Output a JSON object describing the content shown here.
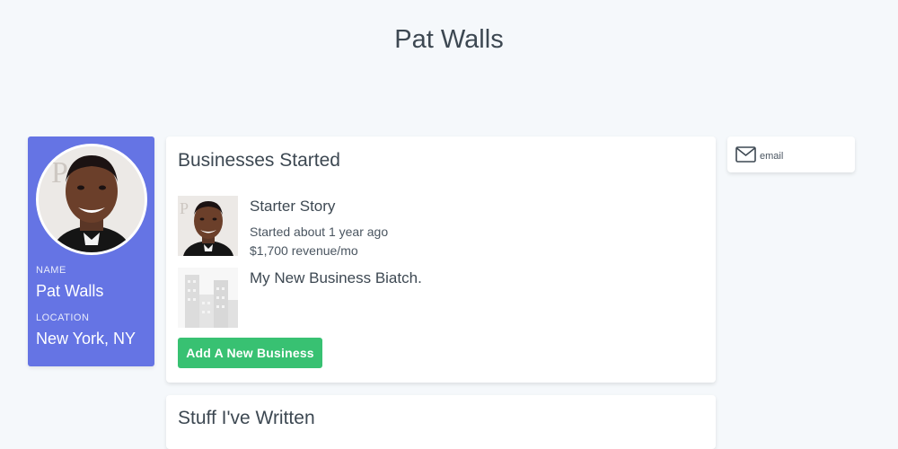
{
  "page": {
    "title": "Pat Walls"
  },
  "profile": {
    "name_label": "NAME",
    "name_value": "Pat Walls",
    "location_label": "LOCATION",
    "location_value": "New York, NY",
    "avatar_icon": "person-photo"
  },
  "businesses": {
    "heading": "Businesses Started",
    "items": [
      {
        "name": "Starter Story",
        "started": "Started about 1 year ago",
        "revenue": "$1,700 revenue/mo",
        "thumbnail": "person-photo"
      },
      {
        "name": "My New Business Biatch.",
        "thumbnail": "buildings-placeholder-icon"
      }
    ],
    "add_button_label": "Add A New Business"
  },
  "writings": {
    "heading": "Stuff I've Written"
  },
  "contact": {
    "email_label": "email",
    "email_icon": "envelope-icon"
  },
  "colors": {
    "background": "#f5f8fb",
    "profile_card": "#6574e4",
    "add_button": "#38c172",
    "text": "#3d4852"
  }
}
